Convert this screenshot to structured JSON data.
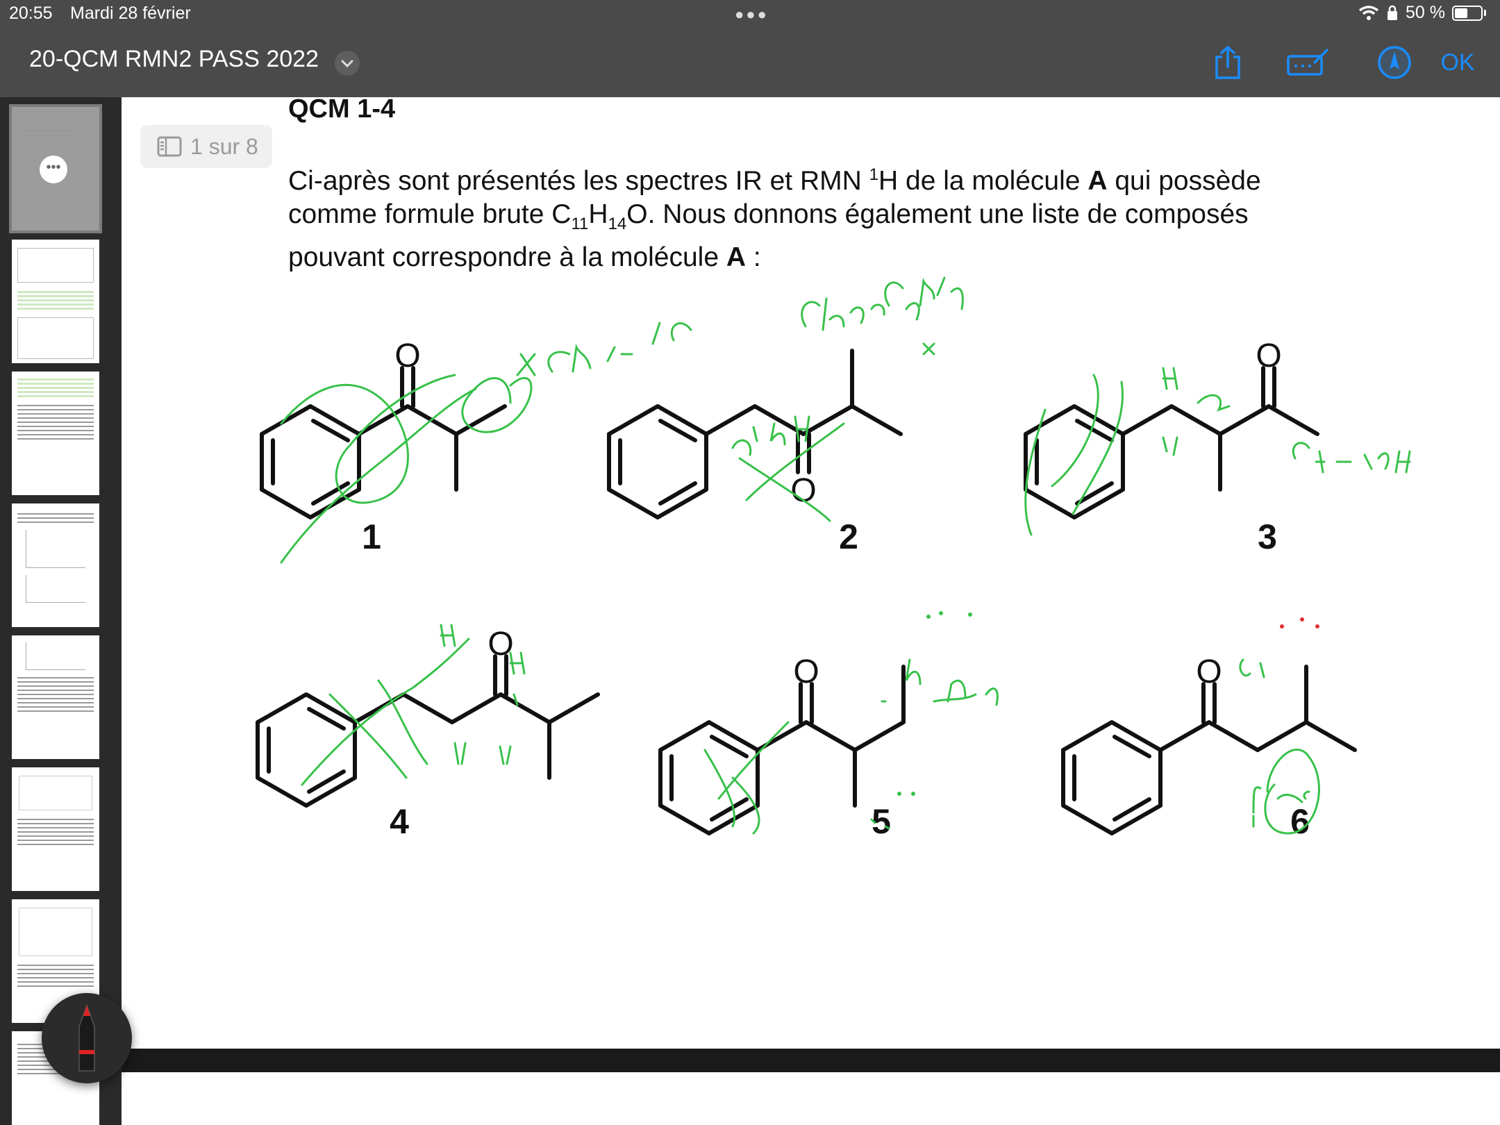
{
  "status": {
    "time": "20:55",
    "date": "Mardi 28 février",
    "battery": "50 %"
  },
  "header": {
    "title": "20-QCM RMN2 PASS 2022",
    "ok_label": "OK"
  },
  "page_indicator": "1 sur 8",
  "question": {
    "title": "QCM 1-4",
    "line1_a": "Ci-après sont présentés les spectres IR et RMN ",
    "line1_sup": "1",
    "line1_b": "H de la molécule ",
    "line1_bold": "A",
    "line1_c": " qui possède",
    "line2_a": "comme formule brute C",
    "line2_sub1": "11",
    "line2_b": "H",
    "line2_sub2": "14",
    "line2_c": "O. Nous donnons également une liste de composés",
    "line3_a": "pouvant correspondre à la molécule ",
    "line3_bold": "A",
    "line3_c": " :"
  },
  "molecules": [
    "1",
    "2",
    "3",
    "4",
    "5",
    "6"
  ],
  "thumbnails": [
    "page-1",
    "page-2",
    "page-3",
    "page-4",
    "page-5",
    "page-6",
    "page-7",
    "page-8"
  ],
  "colors": {
    "accent": "#1a8cff",
    "ink": "#38c14a",
    "topbar": "#4a4a4a"
  }
}
